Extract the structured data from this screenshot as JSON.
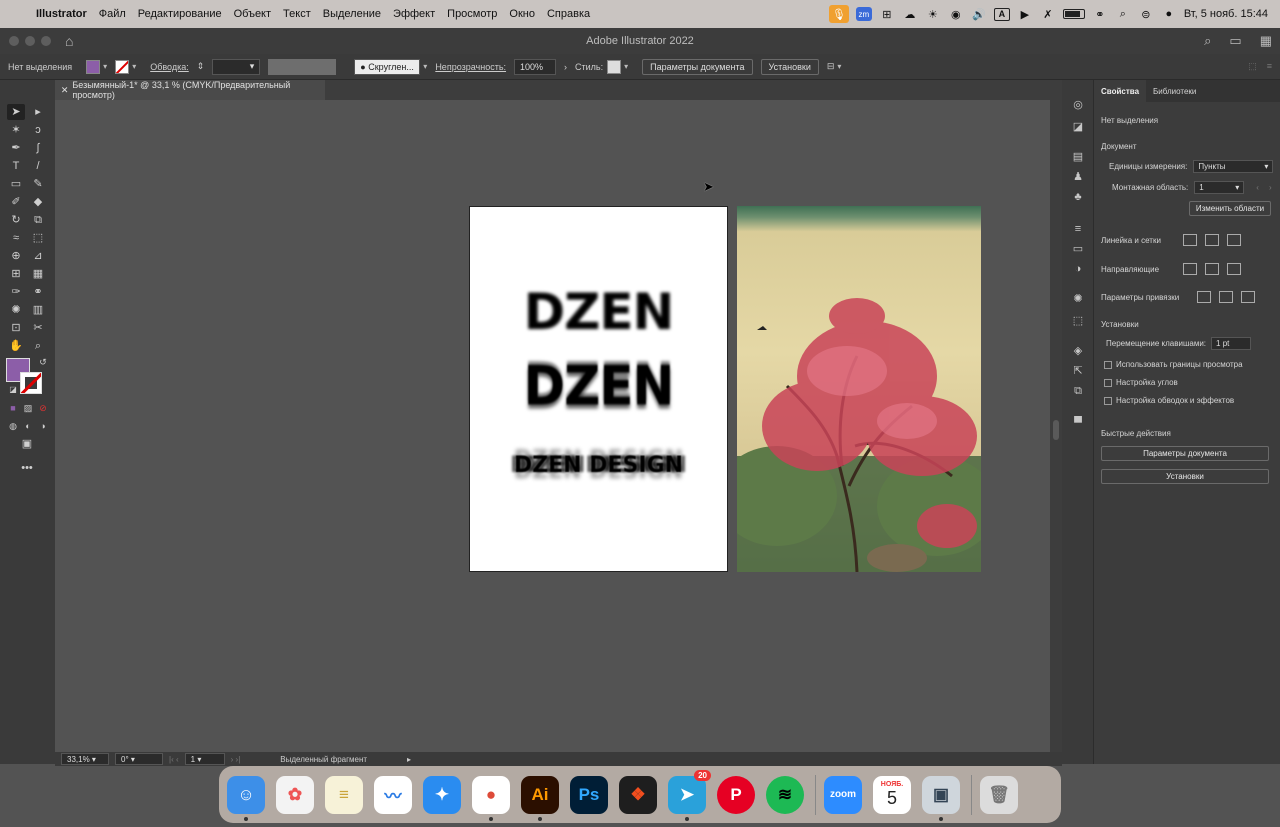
{
  "menubar": {
    "app": "Illustrator",
    "items": [
      "Файл",
      "Редактирование",
      "Объект",
      "Текст",
      "Выделение",
      "Эффект",
      "Просмотр",
      "Окно",
      "Справка"
    ],
    "zoom_icon_text": "zm",
    "input_indicator": "A",
    "datetime": "Вт, 5 нояб.  15:44"
  },
  "window": {
    "title": "Adobe Illustrator 2022"
  },
  "controlbar": {
    "selection_status": "Нет выделения",
    "fill_color": "#8c5ea8",
    "stroke_label": "Обводка:",
    "brush": "Скруглен...",
    "opacity_label": "Непрозрачность:",
    "opacity_value": "100%",
    "style_label": "Стиль:",
    "doc_settings": "Параметры документа",
    "preferences": "Установки"
  },
  "tab": {
    "label": "Безымянный-1* @ 33,1 % (CMYK/Предварительный просмотр)"
  },
  "artboard": {
    "line1": "DZEN",
    "line2": "DZEN",
    "line3": "DZEN DESIGN"
  },
  "statusbar": {
    "zoom": "33,1%",
    "rotation": "0°",
    "artboard_num": "1",
    "tool_status": "Выделенный фрагмент"
  },
  "props": {
    "tab_properties": "Свойства",
    "tab_libraries": "Библиотеки",
    "no_selection": "Нет выделения",
    "document_header": "Документ",
    "units_label": "Единицы измерения:",
    "units_value": "Пункты",
    "artboard_label": "Монтажная область:",
    "artboard_value": "1",
    "edit_artboards": "Изменить области",
    "rulers_grids": "Линейка и сетки",
    "guides": "Направляющие",
    "snap_options": "Параметры привязки",
    "preferences_header": "Установки",
    "keyboard_increment_label": "Перемещение клавишами:",
    "keyboard_increment_value": "1 pt",
    "check_preview_bounds": "Использовать границы просмотра",
    "check_corners": "Настройка углов",
    "check_strokes": "Настройка обводок и эффектов",
    "quick_actions": "Быстрые действия",
    "btn_doc_settings": "Параметры документа",
    "btn_preferences": "Установки"
  },
  "dock": {
    "apps": [
      {
        "name": "Finder",
        "color": "#3d8fe8",
        "glyph": "☺"
      },
      {
        "name": "Photos",
        "color": "#f3f3f3",
        "glyph": "✿"
      },
      {
        "name": "Notes",
        "color": "#f7f2d8",
        "glyph": "≡"
      },
      {
        "name": "Freeform",
        "color": "#ffffff",
        "glyph": "〰"
      },
      {
        "name": "Safari",
        "color": "#2a8cf0",
        "glyph": "✦"
      },
      {
        "name": "Chrome",
        "color": "#ffffff",
        "glyph": "●"
      },
      {
        "name": "Illustrator",
        "color": "#2b0f00",
        "glyph": "Ai"
      },
      {
        "name": "Photoshop",
        "color": "#001e36",
        "glyph": "Ps"
      },
      {
        "name": "Figma",
        "color": "#1e1e1e",
        "glyph": "❖"
      },
      {
        "name": "Telegram",
        "color": "#2aa1da",
        "glyph": "➤"
      },
      {
        "name": "Pinterest",
        "color": "#e60023",
        "glyph": "P"
      },
      {
        "name": "Spotify",
        "color": "#1db954",
        "glyph": "≋"
      },
      {
        "name": "Zoom",
        "color": "#2d8cff",
        "glyph": "zoom"
      },
      {
        "name": "Calendar",
        "color": "#ffffff",
        "glyph": "5"
      },
      {
        "name": "Preview",
        "color": "#cfd6dc",
        "glyph": "▣"
      },
      {
        "name": "Trash",
        "color": "#dcdcdc",
        "glyph": "🗑"
      }
    ],
    "telegram_badge": "20",
    "calendar_month": "НОЯБ."
  }
}
